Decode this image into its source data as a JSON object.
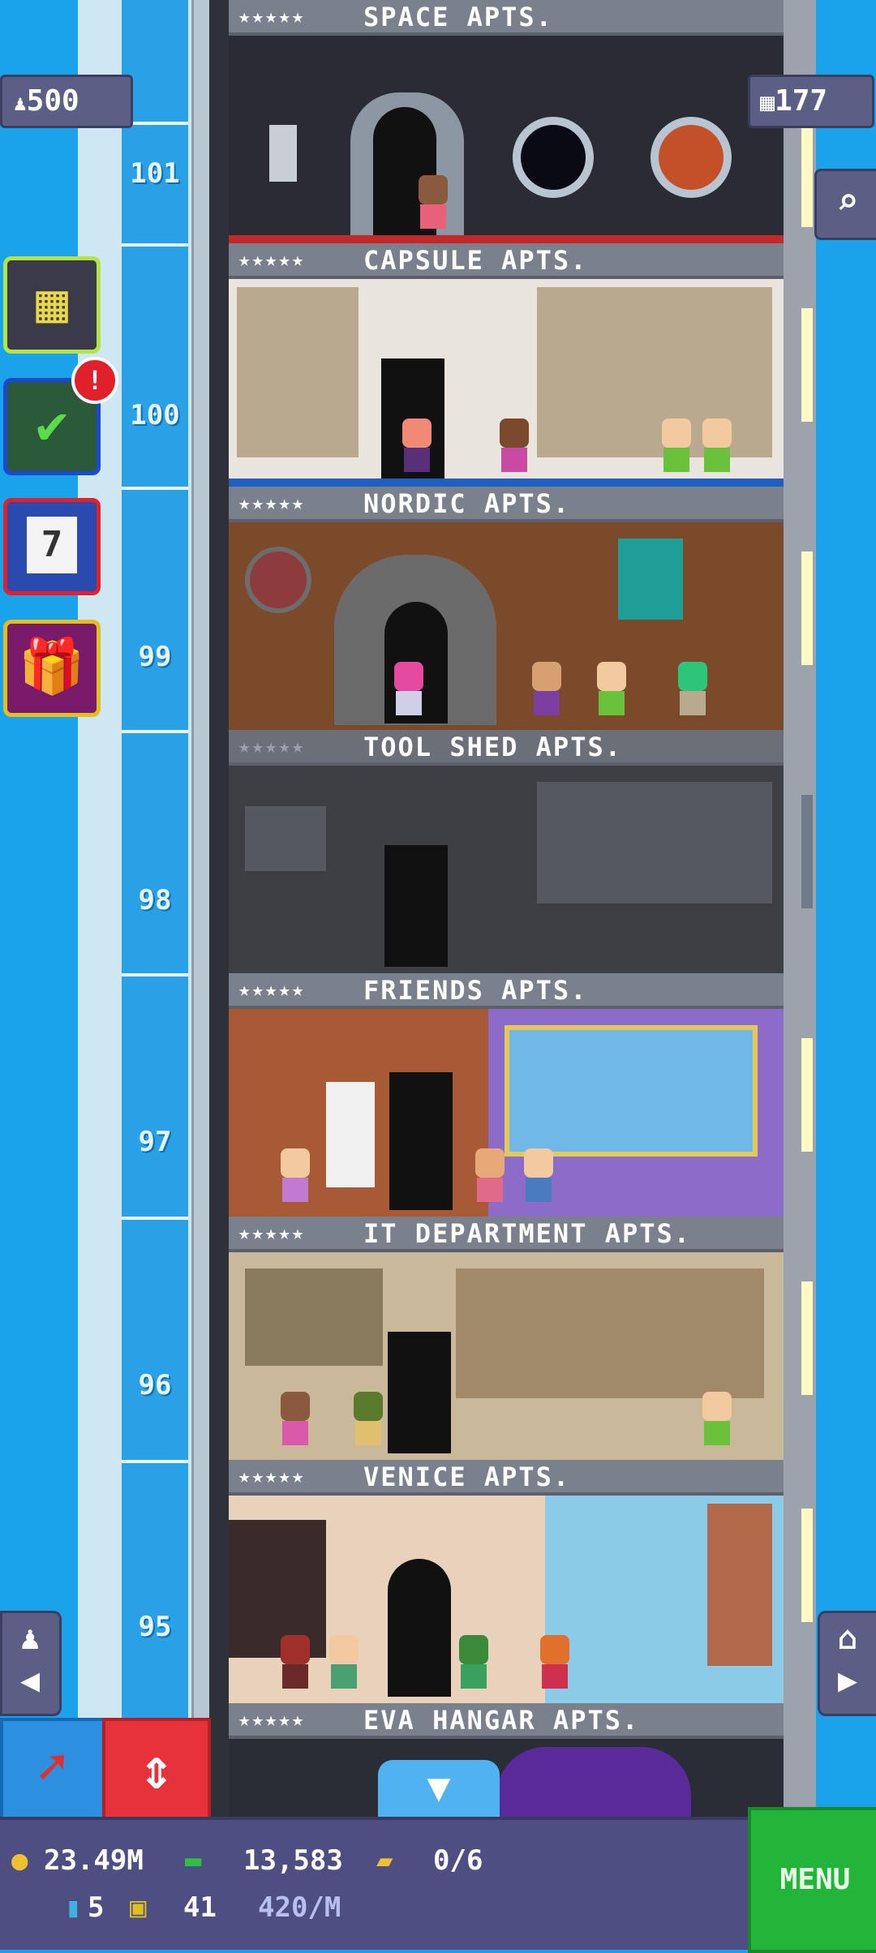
{
  "header": {
    "population": "500",
    "floors": "177"
  },
  "elevator": {
    "floor_numbers": [
      "101",
      "100",
      "99",
      "98",
      "97",
      "96",
      "95"
    ]
  },
  "floors": [
    {
      "name": "SPACE APTS.",
      "stars": "★★★★★"
    },
    {
      "name": "CAPSULE APTS.",
      "stars": "★★★★★"
    },
    {
      "name": "NORDIC APTS.",
      "stars": "★★★★★"
    },
    {
      "name": "TOOL SHED APTS.",
      "stars": "★★★★★"
    },
    {
      "name": "FRIENDS APTS.",
      "stars": "★★★★★"
    },
    {
      "name": "IT DEPARTMENT APTS.",
      "stars": "★★★★★"
    },
    {
      "name": "VENICE APTS.",
      "stars": "★★★★★"
    },
    {
      "name": "EVA HANGAR APTS.",
      "stars": "★★★★★"
    }
  ],
  "side_buttons": {
    "build_icon": "building-grid-icon",
    "missions_icon": "checklist-icon",
    "missions_badge": "!",
    "calendar_icon": "calendar-icon",
    "calendar_day": "7",
    "gift_icon": "gift-icon"
  },
  "bottom_bar": {
    "coins": "23.49M",
    "bux": "13,583",
    "tickets": "0/6",
    "keys": "5",
    "vip": "41",
    "rate": "420/M",
    "menu_label": "MENU"
  },
  "colors": {
    "sky": "#1aa2ea",
    "menu_green": "#22b53a",
    "move_red": "#e8323b",
    "hud_purple": "#4f4e83"
  }
}
